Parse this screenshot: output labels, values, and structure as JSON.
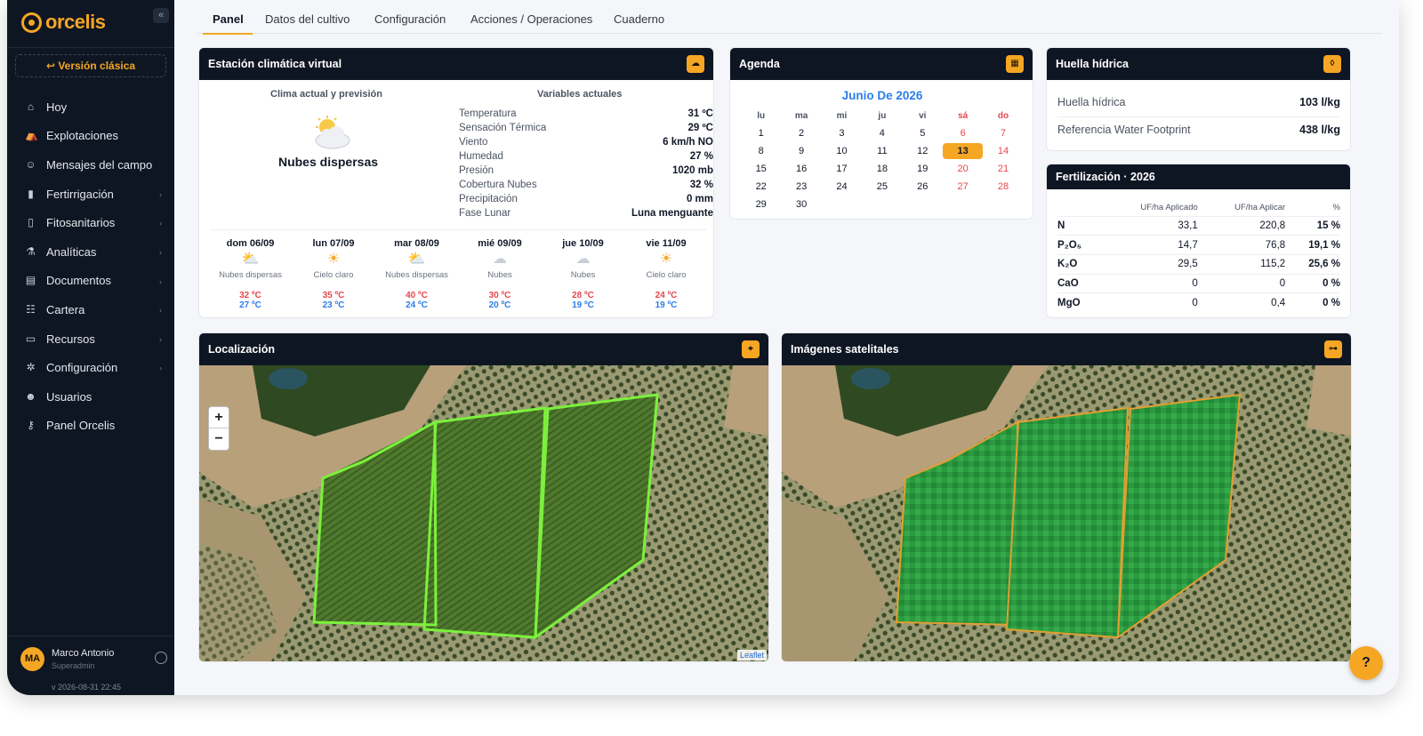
{
  "brand": {
    "name": "orcelis",
    "accent": "#f5a623"
  },
  "sidebar": {
    "collapse_label": "«",
    "classic_label": "↩ Versión clásica",
    "items": [
      {
        "label": "Hoy",
        "icon": "home-icon"
      },
      {
        "label": "Explotaciones",
        "icon": "farm-icon"
      },
      {
        "label": "Mensajes del campo",
        "icon": "farmer-icon"
      },
      {
        "label": "Fertirrigación",
        "icon": "fertigation-icon"
      },
      {
        "label": "Fitosanitarios",
        "icon": "spray-icon"
      },
      {
        "label": "Analíticas",
        "icon": "flask-icon"
      },
      {
        "label": "Documentos",
        "icon": "document-icon"
      },
      {
        "label": "Cartera",
        "icon": "portfolio-icon"
      },
      {
        "label": "Recursos",
        "icon": "folder-icon"
      },
      {
        "label": "Configuración",
        "icon": "gear-icon"
      },
      {
        "label": "Usuarios",
        "icon": "users-icon"
      },
      {
        "label": "Panel Orcelis",
        "icon": "key-icon"
      }
    ],
    "user": {
      "initials": "MA",
      "name": "Marco Antonio",
      "role": "Superadmin"
    },
    "version": "v 2026-08-31 22:45"
  },
  "tabs": [
    "Panel",
    "Datos del cultivo",
    "Configuración",
    "Acciones / Operaciones",
    "Cuaderno"
  ],
  "weather": {
    "title": "Estación climática virtual",
    "current_heading": "Clima actual y previsión",
    "vars_heading": "Variables actuales",
    "condition": "Nubes dispersas",
    "vars": [
      {
        "k": "Temperatura",
        "v": "31 ºC"
      },
      {
        "k": "Sensación Térmica",
        "v": "29 ºC"
      },
      {
        "k": "Viento",
        "v": "6 km/h NO"
      },
      {
        "k": "Humedad",
        "v": "27 %"
      },
      {
        "k": "Presión",
        "v": "1020 mb"
      },
      {
        "k": "Cobertura Nubes",
        "v": "32 %"
      },
      {
        "k": "Precipitación",
        "v": "0 mm"
      },
      {
        "k": "Fase Lunar",
        "v": "Luna menguante"
      }
    ],
    "forecast": [
      {
        "day": "dom 06/09",
        "icon": "⛅",
        "cond": "Nubes dispersas",
        "max": "32 ºC",
        "min": "27 ºC"
      },
      {
        "day": "lun 07/09",
        "icon": "☀",
        "cond": "Cielo claro",
        "max": "35 ºC",
        "min": "23 ºC"
      },
      {
        "day": "mar 08/09",
        "icon": "⛅",
        "cond": "Nubes dispersas",
        "max": "40 ºC",
        "min": "24 ºC"
      },
      {
        "day": "mié 09/09",
        "icon": "☁",
        "cond": "Nubes",
        "max": "30 ºC",
        "min": "20 ºC"
      },
      {
        "day": "jue 10/09",
        "icon": "☁",
        "cond": "Nubes",
        "max": "28 ºC",
        "min": "19 ºC"
      },
      {
        "day": "vie 11/09",
        "icon": "☀",
        "cond": "Cielo claro",
        "max": "24 ºC",
        "min": "19 ºC"
      }
    ]
  },
  "agenda": {
    "title": "Agenda",
    "month": "Junio De 2026",
    "dow": [
      "lu",
      "ma",
      "mi",
      "ju",
      "vi",
      "sá",
      "do"
    ],
    "weeks": [
      [
        "1",
        "2",
        "3",
        "4",
        "5",
        "6",
        "7"
      ],
      [
        "8",
        "9",
        "10",
        "11",
        "12",
        "13",
        "14"
      ],
      [
        "15",
        "16",
        "17",
        "18",
        "19",
        "20",
        "21"
      ],
      [
        "22",
        "23",
        "24",
        "25",
        "26",
        "27",
        "28"
      ],
      [
        "29",
        "30",
        "",
        "",
        "",
        "",
        ""
      ]
    ],
    "today": "13"
  },
  "huella": {
    "title": "Huella hídrica",
    "rows": [
      {
        "k": "Huella hídrica",
        "v": "103 l/kg"
      },
      {
        "k": "Referencia Water Footprint",
        "v": "438 l/kg"
      }
    ]
  },
  "fert": {
    "title": "Fertilización · 2026",
    "headers": [
      "",
      "UF/ha Aplicado",
      "UF/ha Aplicar",
      "%"
    ],
    "rows": [
      {
        "n": "N",
        "a": "33,1",
        "b": "220,8",
        "p": "15 %"
      },
      {
        "n": "P₂O₅",
        "a": "14,7",
        "b": "76,8",
        "p": "19,1 %"
      },
      {
        "n": "K₂O",
        "a": "29,5",
        "b": "115,2",
        "p": "25,6 %"
      },
      {
        "n": "CaO",
        "a": "0",
        "b": "0",
        "p": "0 %"
      },
      {
        "n": "MgO",
        "a": "0",
        "b": "0,4",
        "p": "0 %"
      }
    ]
  },
  "location": {
    "title": "Localización",
    "zoom_in": "+",
    "zoom_out": "−",
    "attribution": "Leaflet"
  },
  "satellite": {
    "title": "Imágenes satelitales"
  },
  "help_label": "?"
}
